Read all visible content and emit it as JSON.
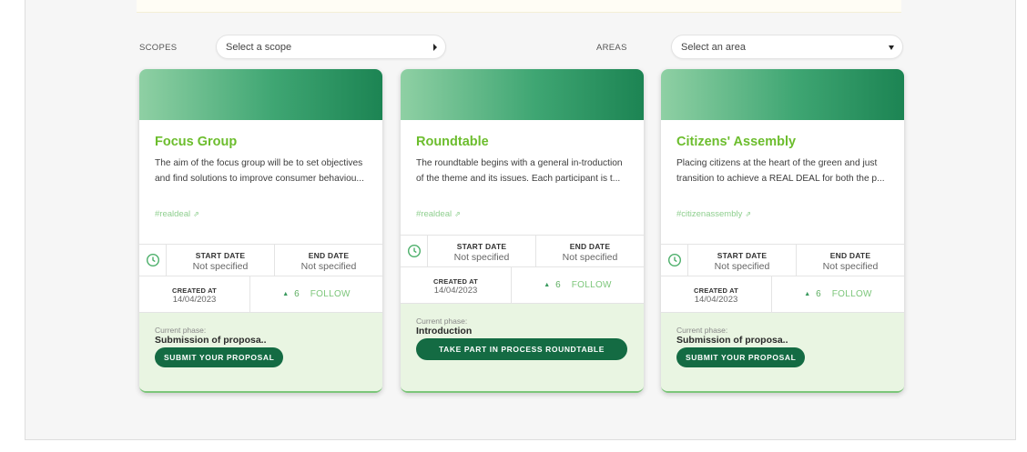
{
  "filters": {
    "scopes_label": "SCOPES",
    "scope_placeholder": "Select a scope",
    "areas_label": "AREAS",
    "area_placeholder": "Select an area"
  },
  "labels": {
    "start_date": "START DATE",
    "end_date": "END DATE",
    "created_at": "CREATED AT",
    "follow": "FOLLOW",
    "current_phase": "Current phase:"
  },
  "cards": [
    {
      "title": "Focus Group",
      "description": "The aim of the focus group will be to set objectives and find solutions to improve consumer behaviou...",
      "tag": "#realdeal",
      "start_date": "Not specified",
      "end_date": "Not specified",
      "created_at": "14/04/2023",
      "follow_count": "6",
      "phase": "Submission of proposa..",
      "button": "SUBMIT YOUR PROPOSAL"
    },
    {
      "title": "Roundtable",
      "description": "The roundtable begins with a general in-troduction of the theme and its issues. Each participant is t...",
      "tag": "#realdeal",
      "start_date": "Not specified",
      "end_date": "Not specified",
      "created_at": "14/04/2023",
      "follow_count": "6",
      "phase": "Introduction",
      "button": "TAKE PART IN PROCESS ROUNDTABLE"
    },
    {
      "title": "Citizens' Assembly",
      "description": "Placing citizens at the heart of the green and just transition to achieve a REAL DEAL for both the p...",
      "tag": "#citizenassembly",
      "start_date": "Not specified",
      "end_date": "Not specified",
      "created_at": "14/04/2023",
      "follow_count": "6",
      "phase": "Submission of proposa..",
      "button": "SUBMIT YOUR PROPOSAL"
    }
  ],
  "colors": {
    "title_green": "#6cbd2d",
    "button_green": "#146b43",
    "phase_bg": "#e9f5e2"
  }
}
